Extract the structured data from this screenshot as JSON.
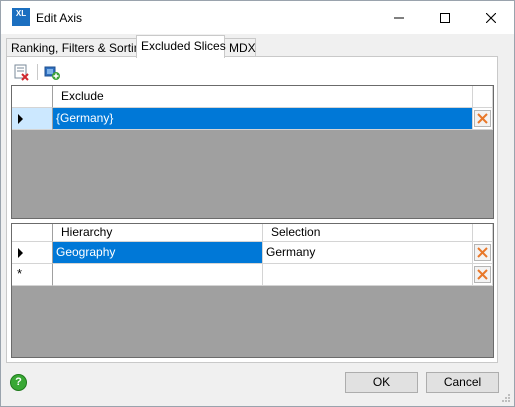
{
  "window": {
    "title": "Edit Axis",
    "app_icon_text": "XL"
  },
  "tabs": [
    {
      "label": "Ranking, Filters & Sorting"
    },
    {
      "label": "Excluded Slices",
      "active": true
    },
    {
      "label": "MDX"
    }
  ],
  "toolbar": {
    "icons": [
      "remove-slice-icon",
      "add-slice-icon"
    ]
  },
  "slices_grid": {
    "columns": [
      "Exclude"
    ],
    "rows": [
      {
        "value": "{Germany}",
        "selected": true
      }
    ]
  },
  "detail_grid": {
    "columns": [
      "Hierarchy",
      "Selection"
    ],
    "rows": [
      {
        "hierarchy": "Geography",
        "selection": "Germany"
      },
      {
        "hierarchy": "",
        "selection": "",
        "new_row": true
      }
    ],
    "new_row_marker": "*"
  },
  "buttons": {
    "ok": "OK",
    "cancel": "Cancel",
    "help": "?"
  },
  "colors": {
    "selection": "#0078d7",
    "delete_x": "#e8782a",
    "grid_background": "#a0a0a0"
  }
}
